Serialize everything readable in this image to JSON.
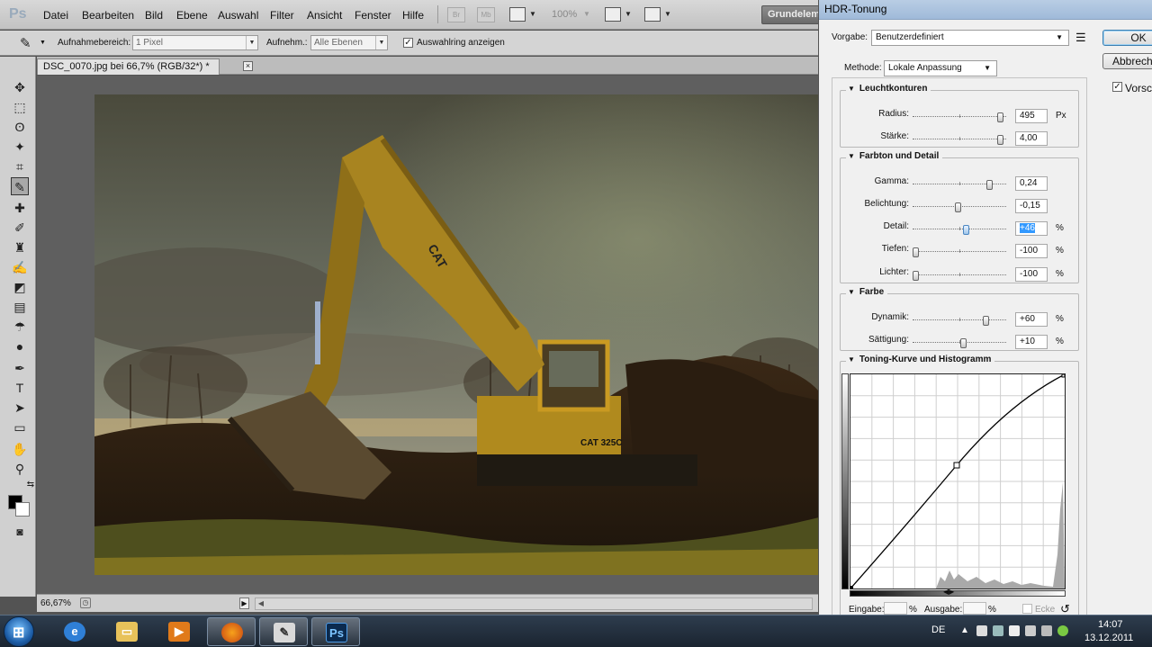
{
  "menubar": {
    "items": [
      "Datei",
      "Bearbeiten",
      "Bild",
      "Ebene",
      "Auswahl",
      "Filter",
      "Ansicht",
      "Fenster",
      "Hilfe"
    ],
    "btn_br": "Br",
    "btn_mb": "Mb",
    "zoom": "100%",
    "workspace": "Grundelemente"
  },
  "options": {
    "sample_area_label": "Aufnahmebereich:",
    "sample_area_value": "1 Pixel",
    "sample_label": "Aufnehm.:",
    "sample_value": "Alle Ebenen",
    "show_ring_label": "Auswahlring anzeigen",
    "show_ring_checked": "✓"
  },
  "document": {
    "tab_title": "DSC_0070.jpg bei 66,7% (RGB/32*) *",
    "close_glyph": "×",
    "status_zoom": "66,67%"
  },
  "hdr": {
    "title": "HDR-Tonung",
    "preset_label": "Vorgabe:",
    "preset_value": "Benutzerdefiniert",
    "method_label": "Methode:",
    "method_value": "Lokale Anpassung",
    "ok": "OK",
    "cancel": "Abbrechen",
    "preview_label": "Vorschau",
    "preview_checked": "✓",
    "groups": {
      "edge_glow": {
        "title": "Leuchtkonturen",
        "params": [
          {
            "label": "Radius:",
            "value": "495",
            "unit": "Px",
            "level": 0.97
          },
          {
            "label": "Stärke:",
            "value": "4,00",
            "unit": "",
            "level": 0.97
          }
        ]
      },
      "tone_detail": {
        "title": "Farbton und Detail",
        "params": [
          {
            "label": "Gamma:",
            "value": "0,24",
            "unit": "",
            "level": 0.85
          },
          {
            "label": "Belichtung:",
            "value": "-0,15",
            "unit": "",
            "level": 0.48
          },
          {
            "label": "Detail:",
            "value": "+46",
            "unit": "%",
            "level": 0.58
          },
          {
            "label": "Tiefen:",
            "value": "-100",
            "unit": "%",
            "level": 0.0
          },
          {
            "label": "Lichter:",
            "value": "-100",
            "unit": "%",
            "level": 0.0
          }
        ]
      },
      "color": {
        "title": "Farbe",
        "params": [
          {
            "label": "Dynamik:",
            "value": "+60",
            "unit": "%",
            "level": 0.8
          },
          {
            "label": "Sättigung:",
            "value": "+10",
            "unit": "%",
            "level": 0.55
          }
        ]
      },
      "curve": {
        "title": "Toning-Kurve und Histogramm"
      }
    },
    "input_label": "Eingabe:",
    "output_label": "Ausgabe:",
    "percent": "%",
    "corner_label": "Ecke"
  },
  "taskbar": {
    "lang": "DE",
    "time": "14:07",
    "date": "13.12.2011"
  }
}
